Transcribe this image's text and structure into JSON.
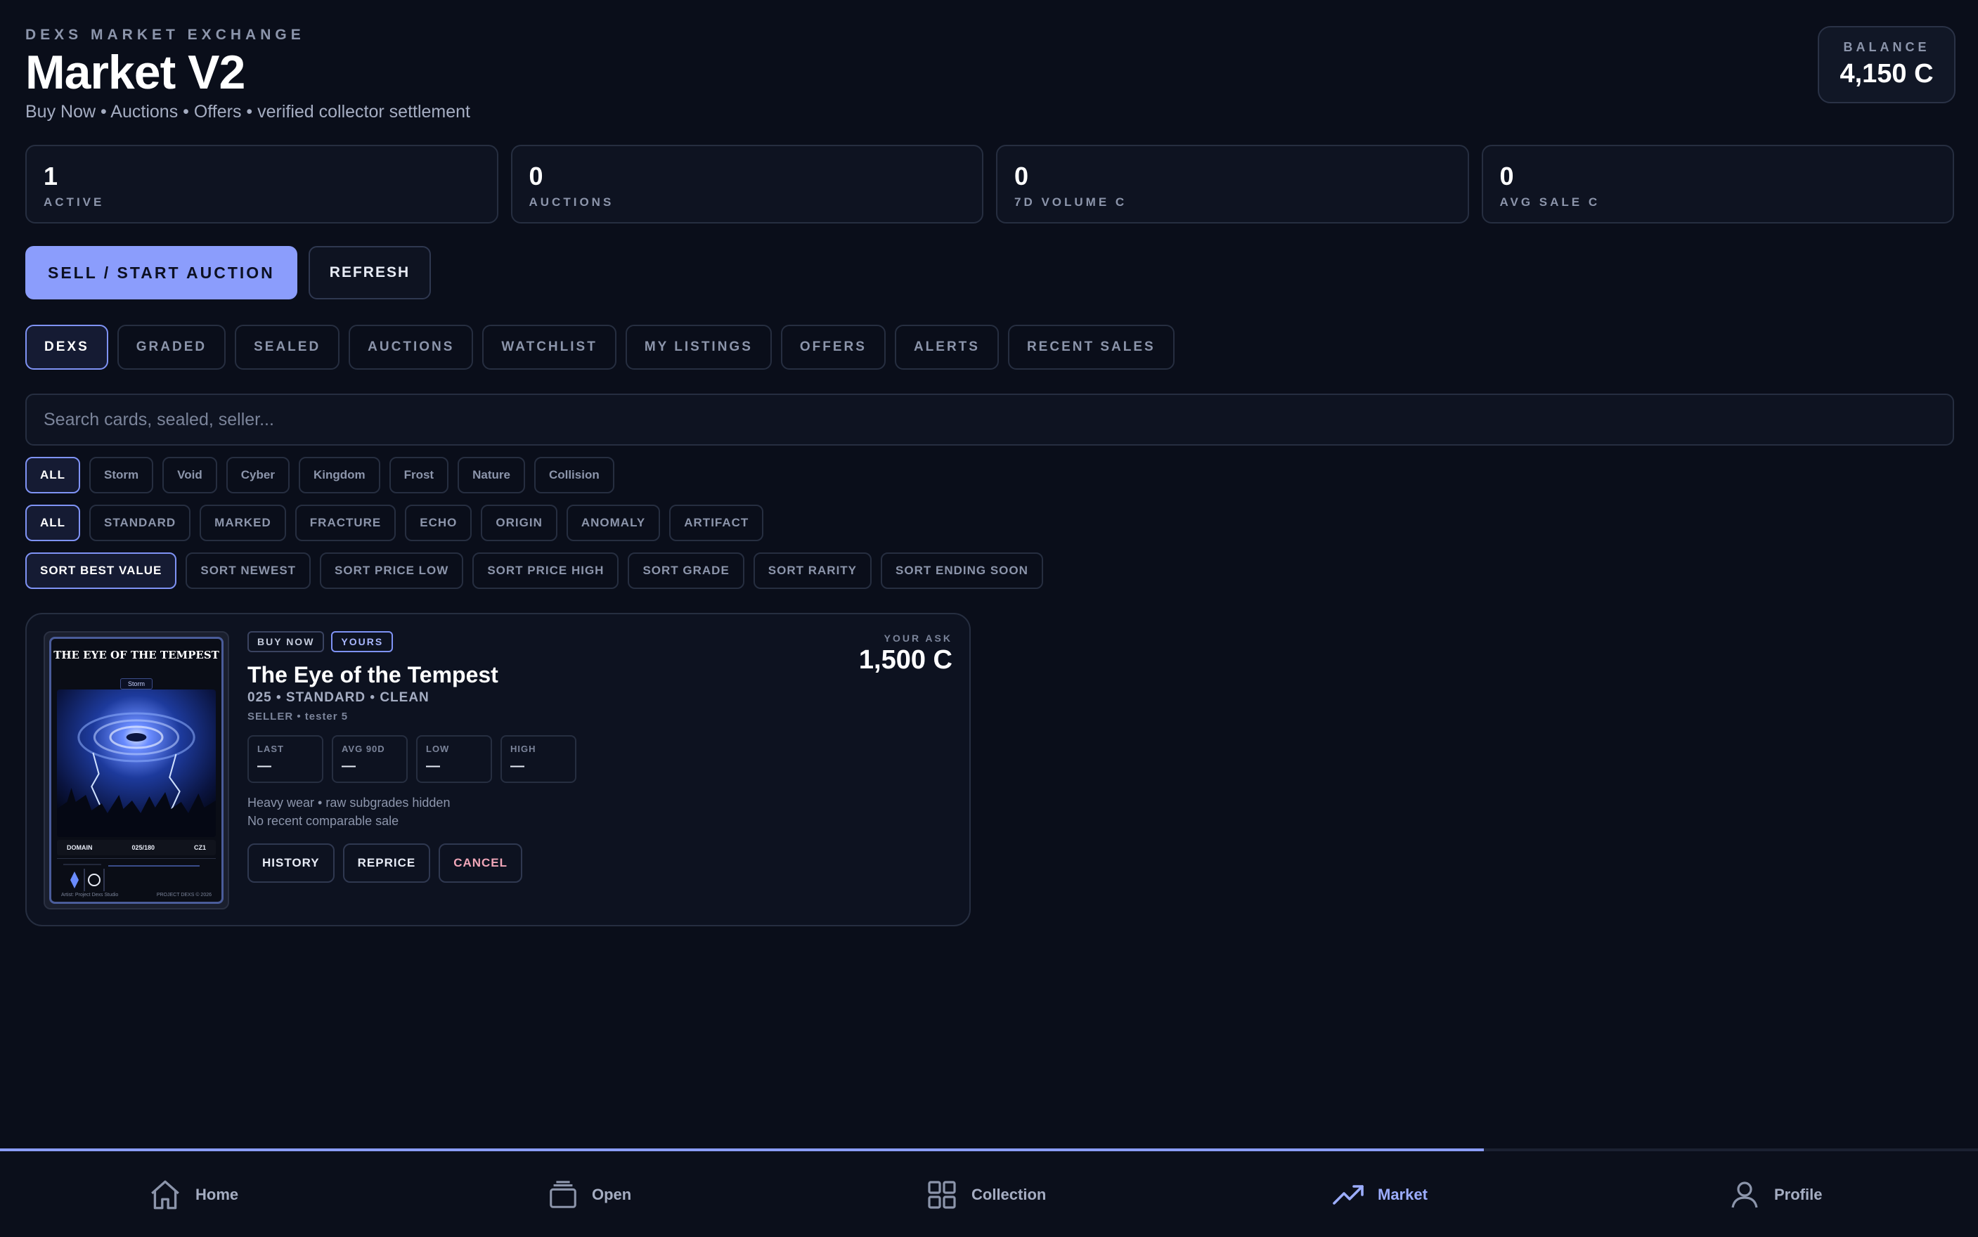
{
  "header": {
    "eyebrow": "DEXS MARKET EXCHANGE",
    "title": "Market V2",
    "subtitle": "Buy Now • Auctions • Offers • verified collector settlement",
    "balance_label": "BALANCE",
    "balance_value": "4,150 C"
  },
  "stats": [
    {
      "value": "1",
      "label": "ACTIVE"
    },
    {
      "value": "0",
      "label": "AUCTIONS"
    },
    {
      "value": "0",
      "label": "7D VOLUME C"
    },
    {
      "value": "0",
      "label": "AVG SALE C"
    }
  ],
  "actions": {
    "primary": "SELL / START AUCTION",
    "refresh": "REFRESH"
  },
  "tabs": [
    "DEXS",
    "GRADED",
    "SEALED",
    "AUCTIONS",
    "WATCHLIST",
    "MY LISTINGS",
    "OFFERS",
    "ALERTS",
    "RECENT SALES"
  ],
  "search": {
    "placeholder": "Search cards, sealed, seller..."
  },
  "domain_filters": [
    "ALL",
    "Storm",
    "Void",
    "Cyber",
    "Kingdom",
    "Frost",
    "Nature",
    "Collision"
  ],
  "type_filters": [
    "ALL",
    "STANDARD",
    "MARKED",
    "FRACTURE",
    "ECHO",
    "ORIGIN",
    "ANOMALY",
    "ARTIFACT"
  ],
  "sort_options": [
    "SORT BEST VALUE",
    "SORT NEWEST",
    "SORT PRICE LOW",
    "SORT PRICE HIGH",
    "SORT GRADE",
    "SORT RARITY",
    "SORT ENDING SOON"
  ],
  "listing": {
    "badges": [
      "BUY NOW",
      "YOURS"
    ],
    "title": "The Eye of the Tempest",
    "meta": "025 • STANDARD • CLEAN",
    "seller": "SELLER • tester 5",
    "stats": [
      {
        "label": "LAST",
        "value": "—"
      },
      {
        "label": "AVG 90D",
        "value": "—"
      },
      {
        "label": "LOW",
        "value": "—"
      },
      {
        "label": "HIGH",
        "value": "—"
      }
    ],
    "note1": "Heavy wear • raw subgrades hidden",
    "note2": "No recent comparable sale",
    "buttons": [
      "HISTORY",
      "REPRICE",
      "CANCEL"
    ],
    "ask_label": "YOUR ASK",
    "ask_value": "1,500 C",
    "card": {
      "title": "THE EYE OF THE TEMPEST",
      "domain_tag": "Storm",
      "footer_left": "DOMAIN",
      "footer_mid": "025/180",
      "footer_right": "CZ1",
      "credit_left": "Artist: Project Dexs Studio",
      "credit_right": "PROJECT DEXS © 2026"
    }
  },
  "progress": {
    "value": 0.75
  },
  "nav": [
    {
      "label": "Home",
      "icon": "home-icon"
    },
    {
      "label": "Open",
      "icon": "open-pack-icon"
    },
    {
      "label": "Collection",
      "icon": "grid-icon"
    },
    {
      "label": "Market",
      "icon": "trending-up-icon",
      "active": true
    },
    {
      "label": "Profile",
      "icon": "user-icon"
    }
  ],
  "colors": {
    "background": "#0a0e1a",
    "accent": "#8b9dfc",
    "danger": "#f0a6b8"
  }
}
